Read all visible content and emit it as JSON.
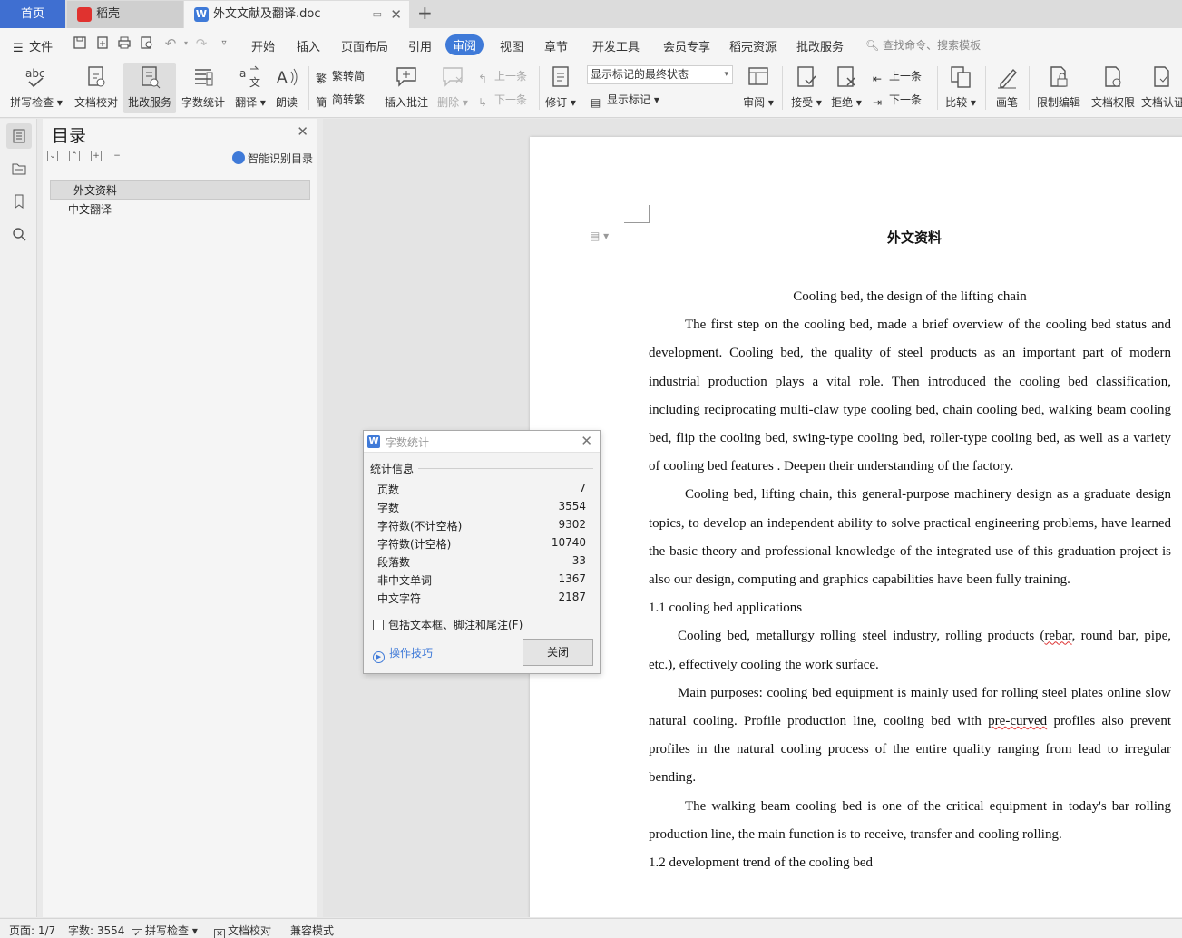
{
  "tabs": {
    "home": "首页",
    "docer": "稻壳",
    "active_doc": "外文文献及翻译.doc"
  },
  "menu": {
    "file": "文件",
    "items": [
      "开始",
      "插入",
      "页面布局",
      "引用",
      "审阅",
      "视图",
      "章节",
      "开发工具",
      "会员专享",
      "稻壳资源",
      "批改服务"
    ],
    "active_index": 4,
    "search_placeholder": "查找命令、搜索模板"
  },
  "ribbon": {
    "spellcheck": "拼写检查",
    "proofread": "文档校对",
    "correction_service": "批改服务",
    "word_count": "字数统计",
    "translate": "翻译",
    "read_aloud": "朗读",
    "trad_to_simp": "繁转简",
    "simp_to_trad": "简转繁",
    "insert_comment": "插入批注",
    "delete": "删除",
    "prev_comment": "上一条",
    "next_comment": "下一条",
    "track_changes": "修订",
    "markup_state": "显示标记的最终状态",
    "show_markup": "显示标记",
    "review_pane": "审阅",
    "accept": "接受",
    "reject": "拒绝",
    "prev_change": "上一条",
    "next_change": "下一条",
    "compare": "比较",
    "pen": "画笔",
    "restrict_edit": "限制编辑",
    "doc_permission": "文档权限",
    "doc_certify": "文档认证"
  },
  "toc": {
    "title": "目录",
    "ai_detect": "智能识别目录",
    "items": [
      "外文资料",
      "中文翻译"
    ]
  },
  "document": {
    "heading": "外文资料",
    "paragraphs": [
      "Cooling bed, the design of the lifting chain",
      "The first step on the cooling bed, made a brief overview of the cooling bed status and development. Cooling bed, the quality of steel products as an important part of modern industrial production plays a vital role. Then introduced the cooling bed classification, including reciprocating multi-claw type cooling bed, chain cooling bed, walking beam cooling bed, flip the cooling bed, swing-type cooling bed, roller-type cooling bed, as well as a variety of cooling bed features . Deepen their understanding of the factory.",
      "Cooling bed, lifting chain, this general-purpose machinery design as a graduate design topics, to develop an independent ability to solve practical engineering problems, have learned the basic theory and professional knowledge of the integrated use of this graduation project is also our design, computing and graphics capabilities have been fully training.",
      "1.1 cooling bed applications",
      "Main purposes: cooling bed equipment is mainly used for rolling steel plates online slow natural cooling. Profile production line, cooling bed with ",
      "pre-curved",
      " profiles also prevent profiles in the natural cooling process of the entire quality ranging from lead to irregular bending.",
      "The walking beam cooling bed is one of the critical equipment in today's bar rolling production line, the main function is to receive, transfer and cooling rolling.",
      "1.2 development trend of the cooling bed"
    ],
    "p_rebar": {
      "before": "Cooling bed, metallurgy rolling steel industry, rolling products (",
      "flagged": "rebar",
      "after": ", round bar, pipe, etc.), effectively cooling the work surface."
    }
  },
  "word_count_dialog": {
    "title": "字数统计",
    "group_label": "统计信息",
    "rows": [
      {
        "label": "页数",
        "value": "7"
      },
      {
        "label": "字数",
        "value": "3554"
      },
      {
        "label": "字符数(不计空格)",
        "value": "9302"
      },
      {
        "label": "字符数(计空格)",
        "value": "10740"
      },
      {
        "label": "段落数",
        "value": "33"
      },
      {
        "label": "非中文单词",
        "value": "1367"
      },
      {
        "label": "中文字符",
        "value": "2187"
      }
    ],
    "include_checkbox": "包括文本框、脚注和尾注(F)",
    "tips_link": "操作技巧",
    "close_button": "关闭"
  },
  "status": {
    "page": "页面: 1/7",
    "words": "字数: 3554",
    "spellcheck": "拼写检查",
    "proofread": "文档校对",
    "compat_mode": "兼容模式"
  },
  "colors": {
    "accent": "#3f7ad8",
    "home_tab": "#3f6fd1"
  }
}
